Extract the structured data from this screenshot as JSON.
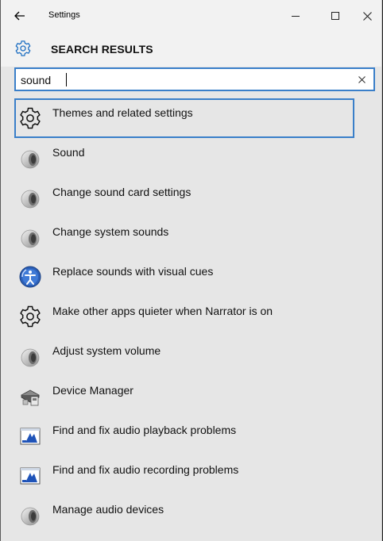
{
  "window": {
    "title": "Settings",
    "back_icon": "back-arrow-icon",
    "controls": [
      "minimize-icon",
      "maximize-icon",
      "close-icon"
    ]
  },
  "header": {
    "icon": "gear-icon",
    "title": "SEARCH RESULTS"
  },
  "search": {
    "value": "sound",
    "clear_icon": "clear-icon"
  },
  "results": [
    {
      "label": "Themes and related settings",
      "icon": "gear-icon",
      "selected": true
    },
    {
      "label": "Sound",
      "icon": "speaker-icon"
    },
    {
      "label": "Change sound card settings",
      "icon": "speaker-icon"
    },
    {
      "label": "Change system sounds",
      "icon": "speaker-icon"
    },
    {
      "label": "Replace sounds with visual cues",
      "icon": "ease-of-access-icon"
    },
    {
      "label": "Make other apps quieter when Narrator is on",
      "icon": "gear-icon"
    },
    {
      "label": "Adjust system volume",
      "icon": "speaker-icon"
    },
    {
      "label": "Device Manager",
      "icon": "device-manager-icon"
    },
    {
      "label": "Find and fix audio playback problems",
      "icon": "troubleshooter-icon"
    },
    {
      "label": "Find and fix audio recording problems",
      "icon": "troubleshooter-icon"
    },
    {
      "label": "Manage audio devices",
      "icon": "speaker-icon"
    }
  ],
  "colors": {
    "accent": "#3a7fc9",
    "background": "#e6e6e6",
    "titlebar": "#f2f2f2"
  }
}
